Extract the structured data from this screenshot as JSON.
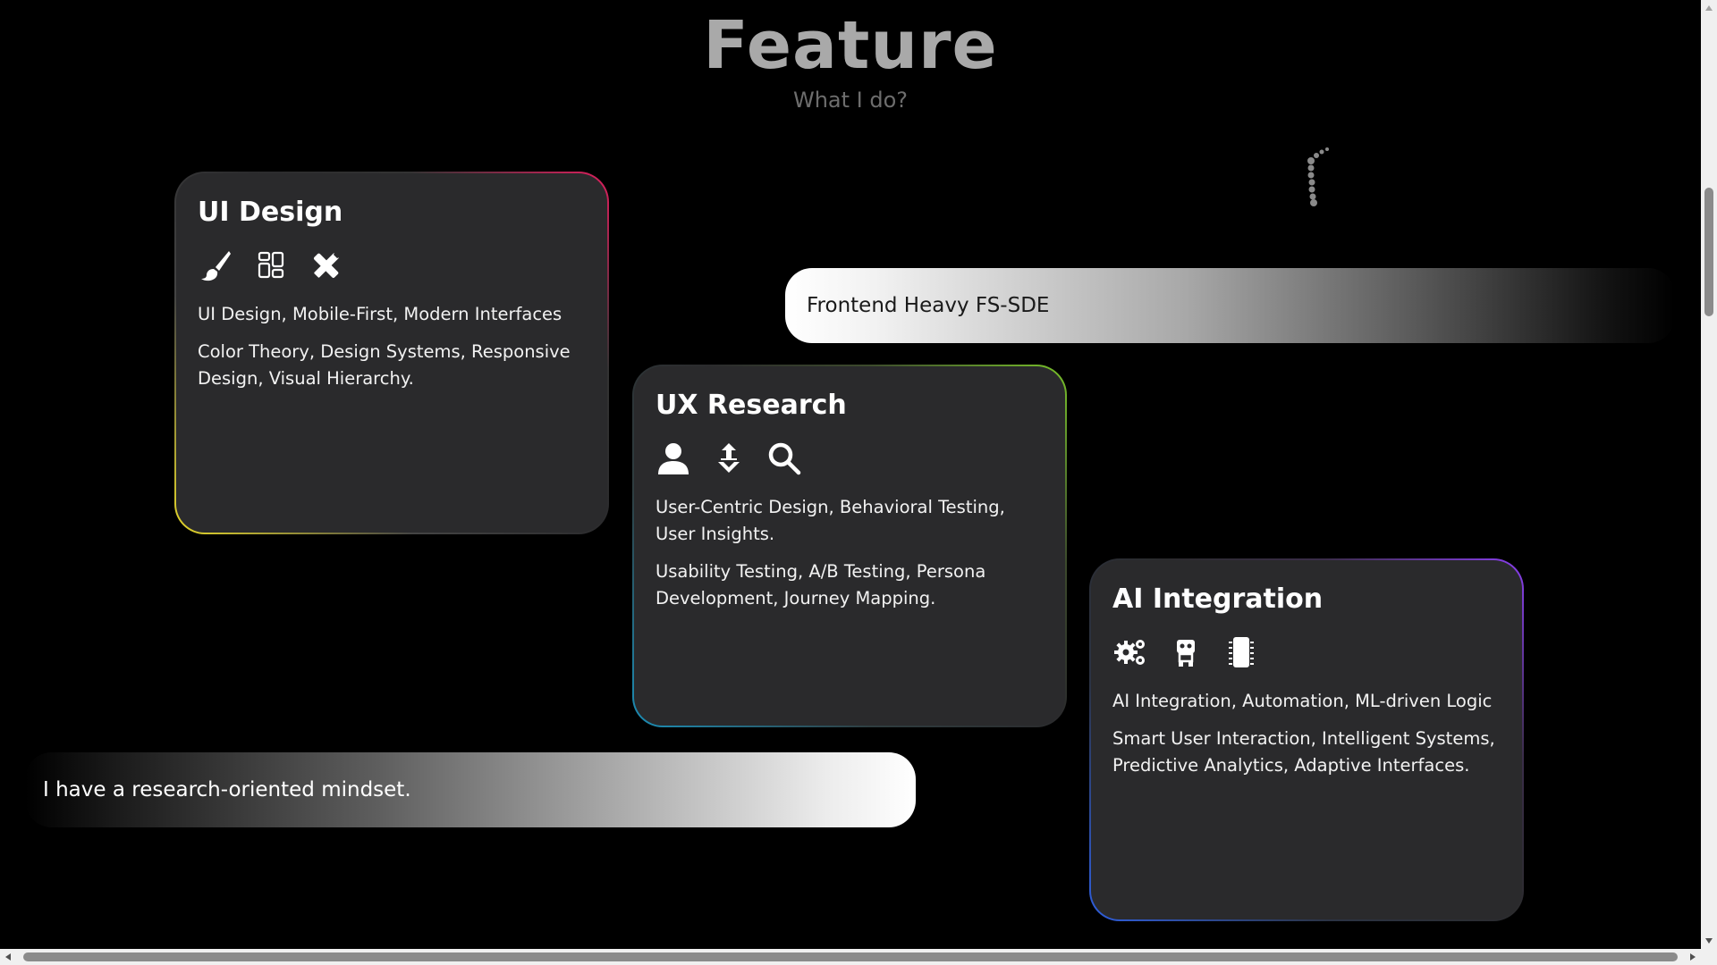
{
  "header": {
    "title": "Feature",
    "subtitle": "What I do?"
  },
  "pills": {
    "right": "Frontend Heavy FS-SDE",
    "left": "I have a research-oriented mindset."
  },
  "cards": [
    {
      "title": "UI Design",
      "icons": [
        "paintbrush-icon",
        "layout-grid-icon",
        "pencil-ruler-icon"
      ],
      "line1": "UI Design, Mobile-First, Modern Interfaces",
      "line2": "Color Theory, Design Systems, Responsive Design, Visual Hierarchy.",
      "border_colors": [
        "#e8d92a",
        "#e01f5e"
      ]
    },
    {
      "title": "UX Research",
      "icons": [
        "user-icon",
        "map-pin-icon",
        "search-icon"
      ],
      "line1": "User-Centric Design, Behavioral Testing, User Insights.",
      "line2": "Usability Testing, A/B Testing, Persona Development, Journey Mapping.",
      "border_colors": [
        "#1b8fb8",
        "#79c22a"
      ]
    },
    {
      "title": "AI Integration",
      "icons": [
        "gears-icon",
        "robot-icon",
        "microchip-icon"
      ],
      "line1": "AI Integration, Automation, ML-driven Logic",
      "line2": "Smart User Interaction, Intelligent Systems, Predictive Analytics, Adaptive Interfaces.",
      "border_colors": [
        "#2f5fe0",
        "#8a3ff0"
      ]
    }
  ],
  "colors": {
    "background": "#000000",
    "card_bg": "#2a2a2c",
    "title": "#a9a9a9",
    "subtitle": "#6d6d6d"
  }
}
